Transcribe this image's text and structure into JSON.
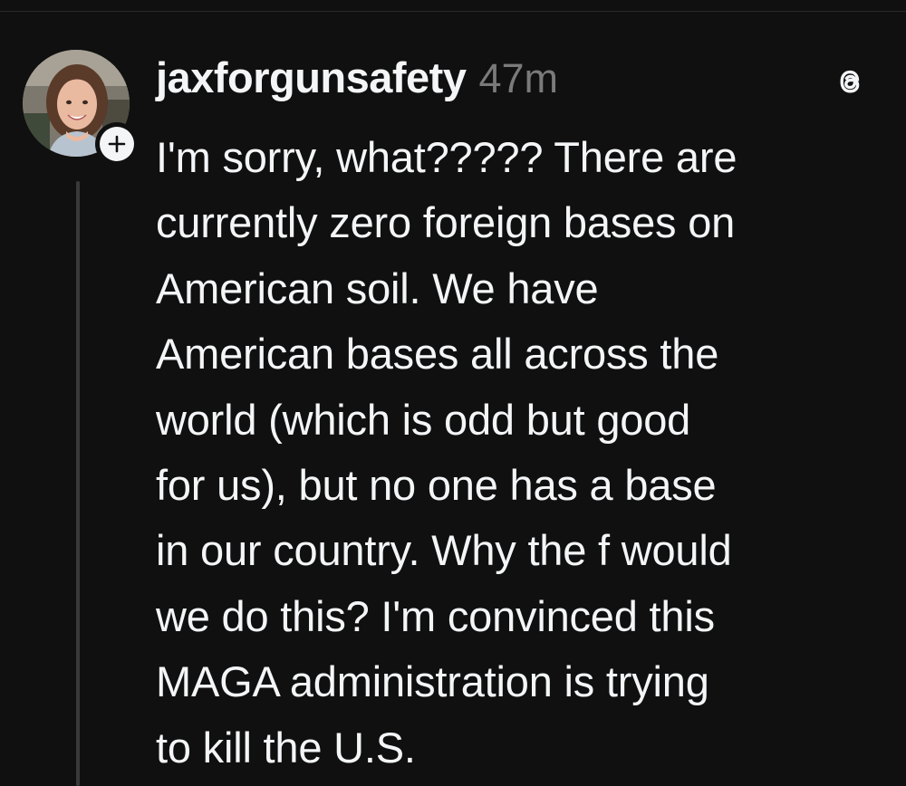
{
  "post": {
    "username": "jaxforgunsafety",
    "timestamp": "47m",
    "body_lines": [
      "I'm sorry, what????? There are",
      "currently zero foreign bases on",
      "American soil. We have",
      "American bases all across the",
      "world (which is odd but good",
      "for us), but no one has a base",
      "in our country. Why the f would",
      "we do this? I'm convinced this",
      "MAGA administration is trying",
      "to kill the U.S."
    ],
    "follow_symbol": "+"
  },
  "icons": {
    "avatar": "avatar-photo",
    "follow": "plus-icon",
    "app": "threads-logo-icon"
  },
  "colors": {
    "background": "#101010",
    "text": "#f3f5f7",
    "muted": "#7a7a7a",
    "thread_line": "#3a3a3a"
  }
}
